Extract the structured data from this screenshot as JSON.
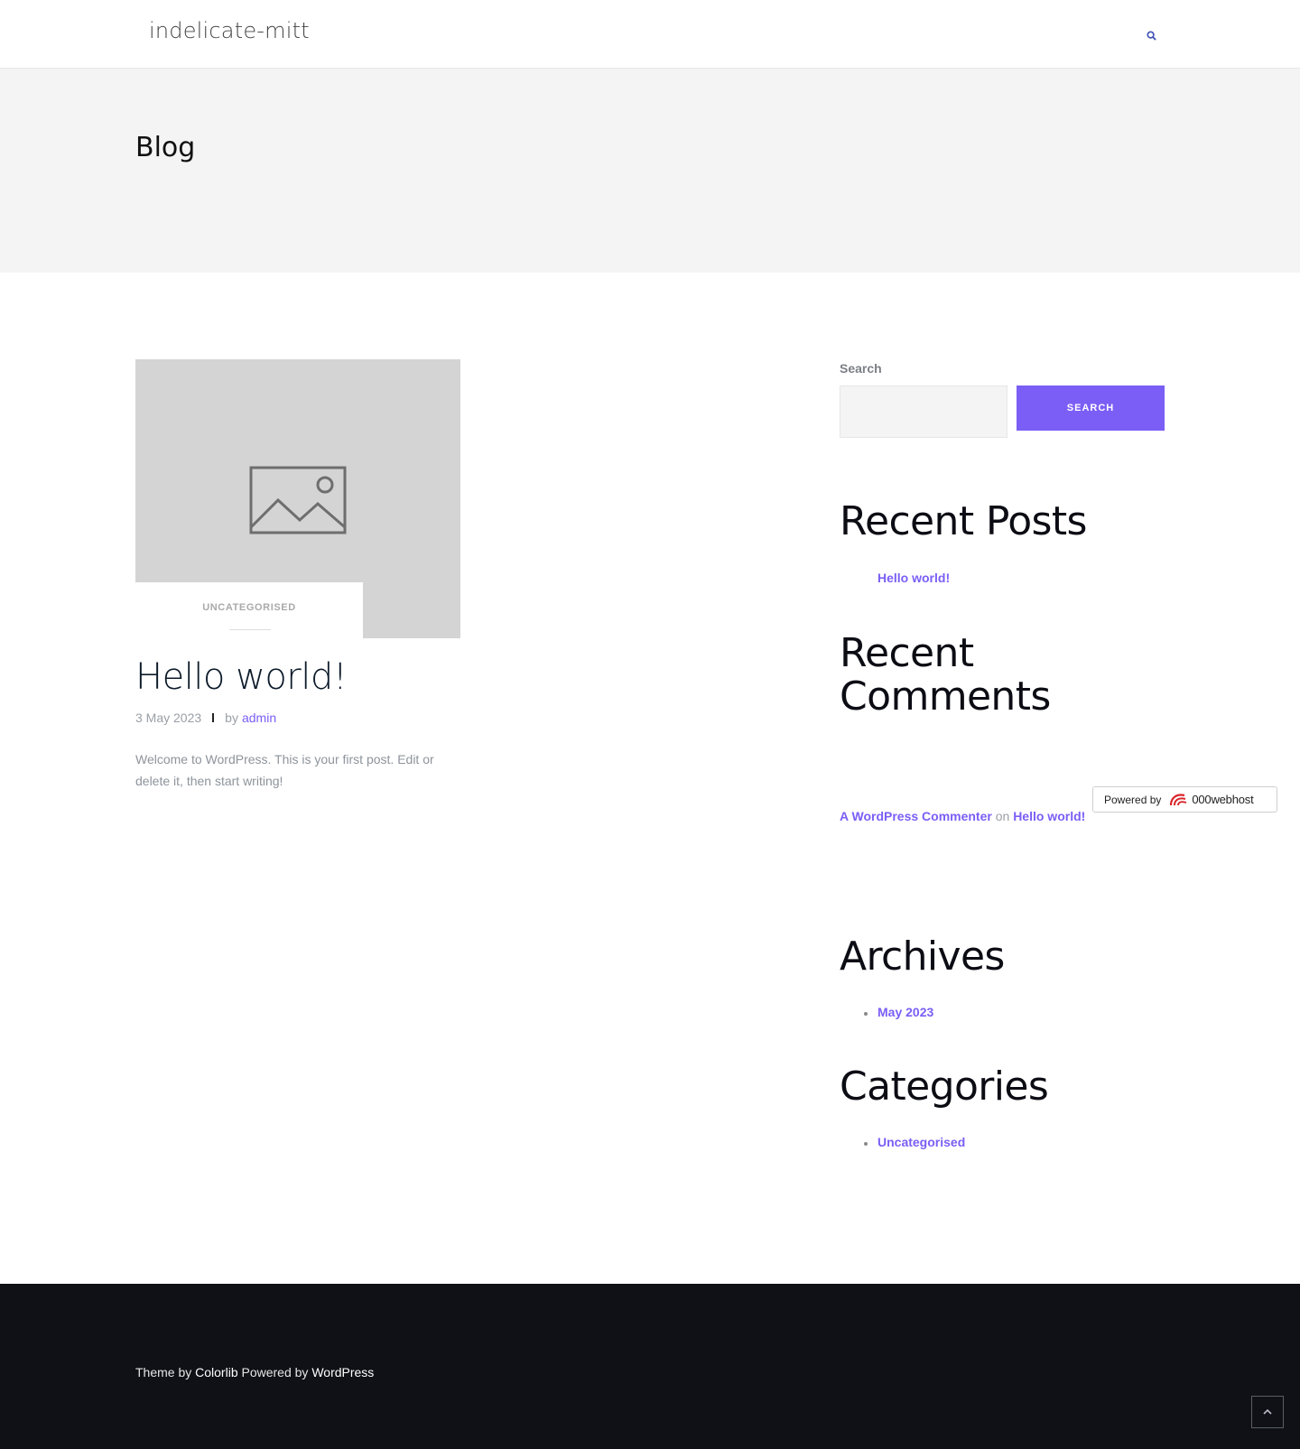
{
  "header": {
    "site_title": "indelicate-mitt",
    "search_icon": "search-icon"
  },
  "page": {
    "title": "Blog"
  },
  "post": {
    "image_icon": "image-placeholder-icon",
    "category": "UNCATEGORISED",
    "title": "Hello world!",
    "date": "3 May 2023",
    "by": "by",
    "author": "admin",
    "excerpt": "Welcome to WordPress. This is your first post. Edit or delete it, then start writing!"
  },
  "sidebar": {
    "search": {
      "label": "Search",
      "placeholder": "",
      "button_label": "SEARCH"
    },
    "recent_posts": {
      "title": "Recent Posts",
      "items": [
        "Hello world!"
      ]
    },
    "recent_comments": {
      "title": "Recent Comments",
      "items": [
        {
          "author": "A WordPress Commenter",
          "on": "on",
          "post": "Hello world!"
        }
      ]
    },
    "archives": {
      "title": "Archives",
      "items": [
        "May 2023"
      ]
    },
    "categories": {
      "title": "Categories",
      "items": [
        "Uncategorised"
      ]
    }
  },
  "badge": {
    "powered_by": "Powered by",
    "brand": "000webhost",
    "logo_icon": "000webhost-logo-icon"
  },
  "footer": {
    "theme_by": "Theme by",
    "theme_author": "Colorlib",
    "powered_by": "Powered by",
    "platform": "WordPress",
    "back_to_top_icon": "chevron-up-icon"
  },
  "colors": {
    "accent": "#7b5ef5",
    "band_bg": "#f4f4f4",
    "footer_bg": "#0f1116",
    "thumb_bg": "#d4d4d4"
  }
}
